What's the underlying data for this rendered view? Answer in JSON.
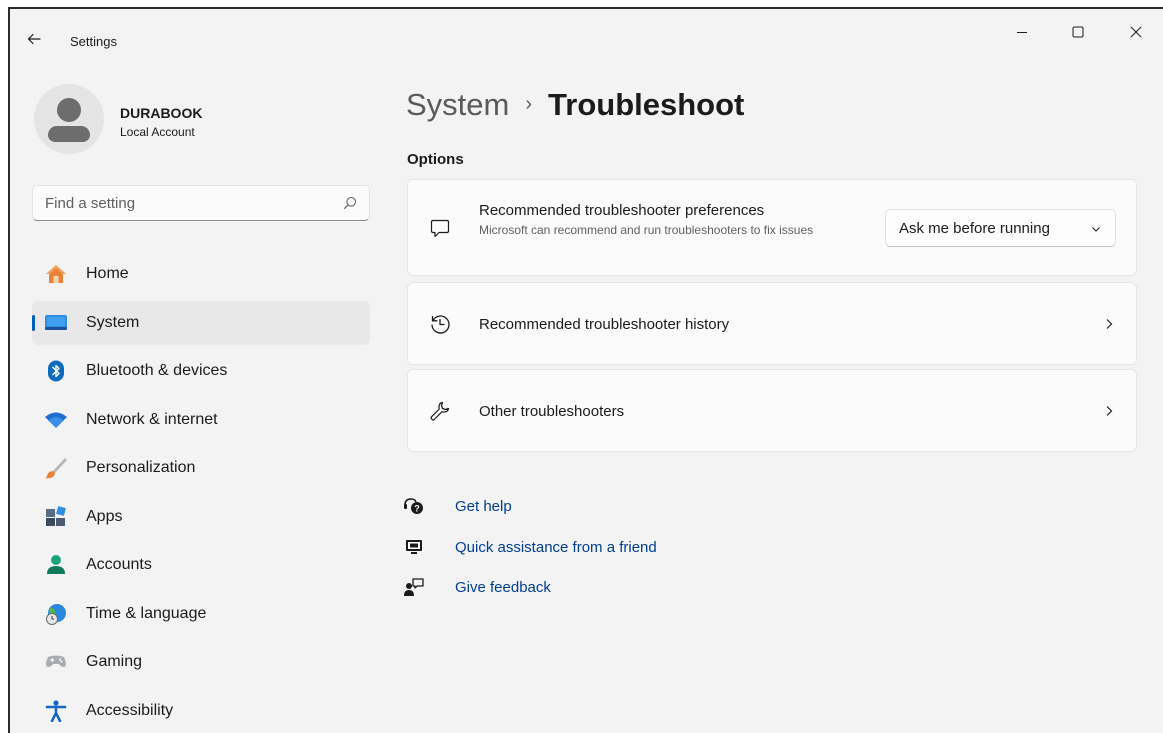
{
  "window": {
    "title": "Settings",
    "controls": [
      "minimize",
      "maximize",
      "close"
    ]
  },
  "user": {
    "name": "DURABOOK",
    "account_type": "Local Account"
  },
  "search": {
    "placeholder": "Find a setting"
  },
  "sidebar": {
    "items": [
      {
        "label": "Home",
        "icon": "home-icon",
        "selected": false
      },
      {
        "label": "System",
        "icon": "system-icon",
        "selected": true
      },
      {
        "label": "Bluetooth & devices",
        "icon": "bluetooth-icon",
        "selected": false
      },
      {
        "label": "Network & internet",
        "icon": "wifi-icon",
        "selected": false
      },
      {
        "label": "Personalization",
        "icon": "brush-icon",
        "selected": false
      },
      {
        "label": "Apps",
        "icon": "apps-icon",
        "selected": false
      },
      {
        "label": "Accounts",
        "icon": "accounts-icon",
        "selected": false
      },
      {
        "label": "Time & language",
        "icon": "time-language-icon",
        "selected": false
      },
      {
        "label": "Gaming",
        "icon": "gaming-icon",
        "selected": false
      },
      {
        "label": "Accessibility",
        "icon": "accessibility-icon",
        "selected": false
      }
    ]
  },
  "breadcrumb": {
    "parent": "System",
    "separator": "›",
    "current": "Troubleshoot"
  },
  "options": {
    "title": "Options",
    "cards": [
      {
        "title": "Recommended troubleshooter preferences",
        "description": "Microsoft can recommend and run troubleshooters to fix issues",
        "icon": "chat-bubble-icon",
        "control": {
          "type": "dropdown",
          "value": "Ask me before running"
        }
      },
      {
        "title": "Recommended troubleshooter history",
        "icon": "history-icon",
        "control": {
          "type": "chevron"
        }
      },
      {
        "title": "Other troubleshooters",
        "icon": "wrench-icon",
        "control": {
          "type": "chevron"
        }
      }
    ]
  },
  "help_links": [
    {
      "label": "Get help",
      "icon": "get-help-icon"
    },
    {
      "label": "Quick assistance from a friend",
      "icon": "quick-assist-icon"
    },
    {
      "label": "Give feedback",
      "icon": "feedback-icon"
    }
  ],
  "colors": {
    "accent": "#005fb8",
    "link": "#003e92",
    "window_bg": "#f3f3f3",
    "card_bg": "#fbfbfb",
    "selected_bg": "#e8e8e8"
  }
}
